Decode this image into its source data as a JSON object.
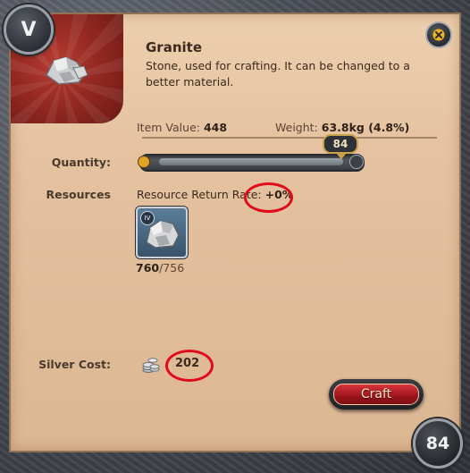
{
  "tier_badge": "V",
  "item": {
    "name": "Granite",
    "description": "Stone, used for crafting. It can be changed to a better material.",
    "value_label": "Item Value:",
    "value": "448",
    "weight_label": "Weight:",
    "weight": "63.8kg (4.8%)"
  },
  "quantity": {
    "label": "Quantity:",
    "value": "84",
    "slider_fraction": 1.0
  },
  "resources": {
    "label": "Resources",
    "return_rate_label": "Resource Return Rate:",
    "return_rate_value": "+0%",
    "resource_tier": "IV",
    "count_have": "760",
    "count_need": "/756"
  },
  "silver": {
    "label": "Silver Cost:",
    "value": "202"
  },
  "craft_button": "Craft",
  "corner_count": "84",
  "icons": {
    "close": "close-icon",
    "coins": "silver-coins-icon",
    "item": "granite-stone-icon"
  },
  "colors": {
    "craft_red": "#c2242c",
    "annotation_red": "#e00a1a",
    "panel": "#e4c19f"
  }
}
